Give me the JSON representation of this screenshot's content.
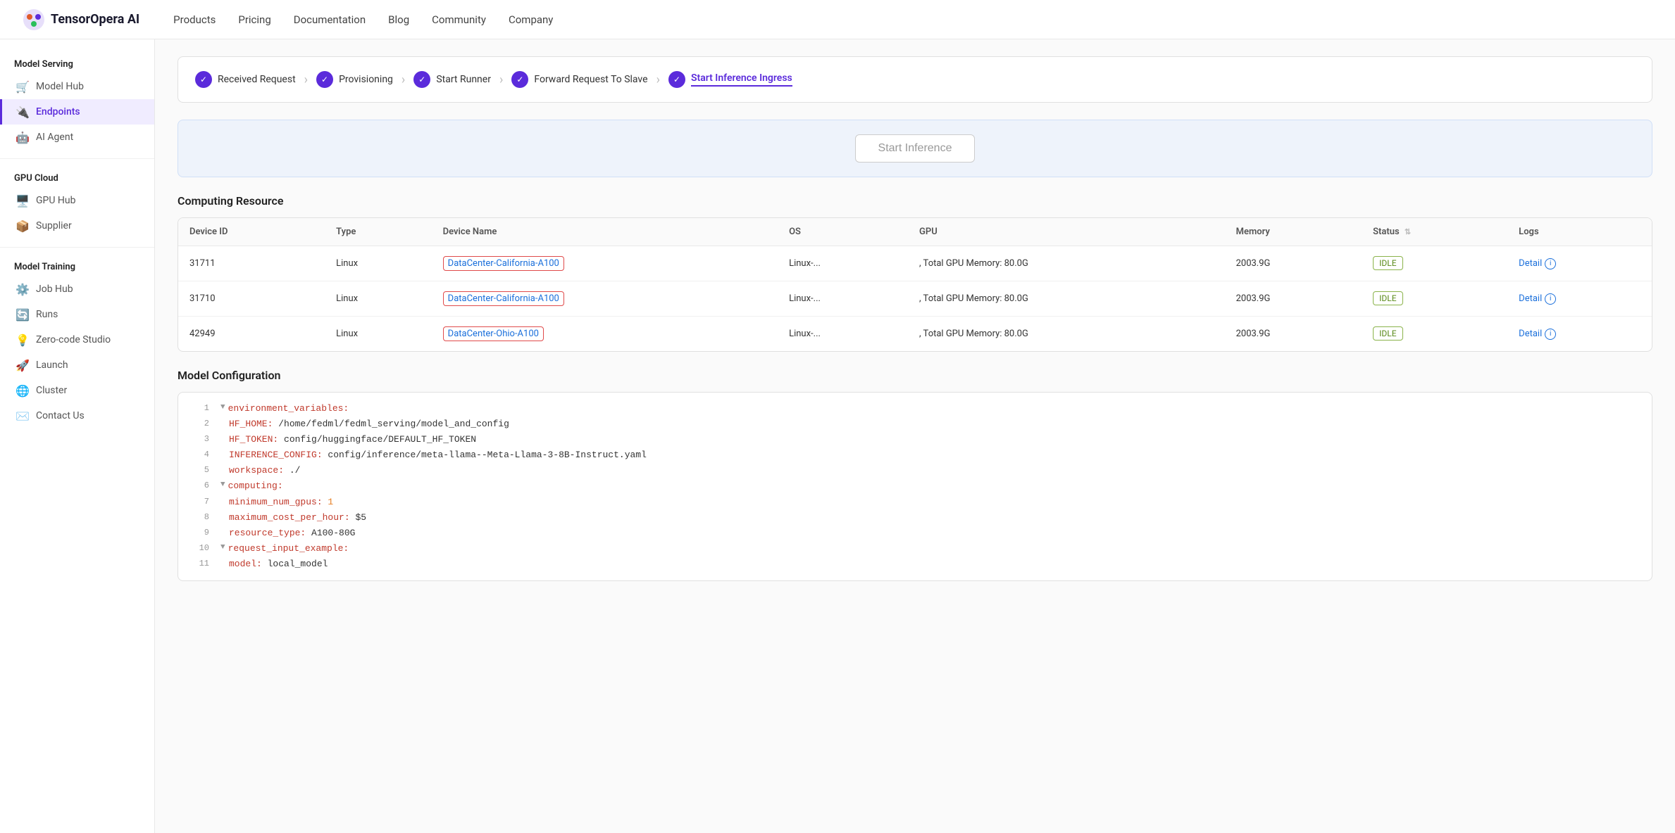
{
  "brand": {
    "name": "TensorOpera AI",
    "logo_emoji": "🎛️"
  },
  "nav": {
    "items": [
      "Products",
      "Pricing",
      "Documentation",
      "Blog",
      "Community",
      "Company"
    ]
  },
  "sidebar": {
    "model_serving_label": "Model Serving",
    "model_serving_items": [
      {
        "id": "model-hub",
        "label": "Model Hub",
        "icon": "🛒"
      },
      {
        "id": "endpoints",
        "label": "Endpoints",
        "icon": "🔌",
        "active": true
      },
      {
        "id": "ai-agent",
        "label": "AI Agent",
        "icon": "🤖"
      }
    ],
    "gpu_cloud_label": "GPU Cloud",
    "gpu_cloud_items": [
      {
        "id": "gpu-hub",
        "label": "GPU Hub",
        "icon": "🖥️"
      },
      {
        "id": "supplier",
        "label": "Supplier",
        "icon": "📦"
      }
    ],
    "model_training_label": "Model Training",
    "model_training_items": [
      {
        "id": "job-hub",
        "label": "Job Hub",
        "icon": "⚙️"
      },
      {
        "id": "runs",
        "label": "Runs",
        "icon": "🔄"
      },
      {
        "id": "zero-code",
        "label": "Zero-code Studio",
        "icon": "💡"
      },
      {
        "id": "launch",
        "label": "Launch",
        "icon": "🚀"
      },
      {
        "id": "cluster",
        "label": "Cluster",
        "icon": "🌐"
      },
      {
        "id": "contact",
        "label": "Contact Us",
        "icon": "✉️"
      }
    ]
  },
  "steps": [
    {
      "id": "received-request",
      "label": "Received Request",
      "done": true
    },
    {
      "id": "provisioning",
      "label": "Provisioning",
      "done": true
    },
    {
      "id": "start-runner",
      "label": "Start Runner",
      "done": true
    },
    {
      "id": "forward-request",
      "label": "Forward Request To Slave",
      "done": true
    },
    {
      "id": "start-inference-ingress",
      "label": "Start Inference Ingress",
      "done": true,
      "active": true
    }
  ],
  "inference_button_label": "Start Inference",
  "computing_resource": {
    "title": "Computing Resource",
    "columns": [
      "Device ID",
      "Type",
      "Device Name",
      "OS",
      "GPU",
      "Memory",
      "Status",
      "Logs"
    ],
    "rows": [
      {
        "device_id": "31711",
        "type": "Linux",
        "device_name": "DataCenter-California-A100",
        "os": "Linux-...",
        "gpu": ", Total GPU Memory: 80.0G",
        "memory": "2003.9G",
        "status": "IDLE",
        "logs_label": "Detail"
      },
      {
        "device_id": "31710",
        "type": "Linux",
        "device_name": "DataCenter-California-A100",
        "os": "Linux-...",
        "gpu": ", Total GPU Memory: 80.0G",
        "memory": "2003.9G",
        "status": "IDLE",
        "logs_label": "Detail"
      },
      {
        "device_id": "42949",
        "type": "Linux",
        "device_name": "DataCenter-Ohio-A100",
        "os": "Linux-...",
        "gpu": ", Total GPU Memory: 80.0G",
        "memory": "2003.9G",
        "status": "IDLE",
        "logs_label": "Detail"
      }
    ]
  },
  "model_configuration": {
    "title": "Model Configuration",
    "lines": [
      {
        "num": 1,
        "collapse": true,
        "content": "environment_variables:",
        "type": "key"
      },
      {
        "num": 2,
        "collapse": false,
        "content": "  HF_HOME: /home/fedml/fedml_serving/model_and_config",
        "type": "mixed",
        "indent": "    ",
        "key": "HF_HOME:",
        "value": " /home/fedml/fedml_serving/model_and_config"
      },
      {
        "num": 3,
        "collapse": false,
        "content": "  HF_TOKEN: config/huggingface/DEFAULT_HF_TOKEN",
        "type": "mixed",
        "key": "HF_TOKEN:",
        "value": " config/huggingface/DEFAULT_HF_TOKEN"
      },
      {
        "num": 4,
        "collapse": false,
        "content": "  INFERENCE_CONFIG: config/inference/meta-llama--Meta-Llama-3-8B-Instruct.yaml",
        "type": "mixed",
        "key": "INFERENCE_CONFIG:",
        "value": " config/inference/meta-llama--Meta-Llama-3-8B-Instruct.yaml"
      },
      {
        "num": 5,
        "collapse": false,
        "content": "workspace: ./",
        "type": "mixed",
        "key": "workspace:",
        "value": " ./"
      },
      {
        "num": 6,
        "collapse": true,
        "content": "computing:",
        "type": "key"
      },
      {
        "num": 7,
        "collapse": false,
        "content": "  minimum_num_gpus: 1",
        "type": "mixed",
        "key": "  minimum_num_gpus:",
        "value_num": " 1"
      },
      {
        "num": 8,
        "collapse": false,
        "content": "  maximum_cost_per_hour: $5",
        "type": "mixed",
        "key": "  maximum_cost_per_hour:",
        "value": " $5"
      },
      {
        "num": 9,
        "collapse": false,
        "content": "  resource_type: A100-80G",
        "type": "mixed",
        "key": "  resource_type:",
        "value": " A100-80G"
      },
      {
        "num": 10,
        "collapse": true,
        "content": "request_input_example:",
        "type": "key"
      },
      {
        "num": 11,
        "collapse": false,
        "content": "  model: local_model",
        "type": "mixed",
        "key": "  model:",
        "value": " local_model"
      }
    ]
  }
}
